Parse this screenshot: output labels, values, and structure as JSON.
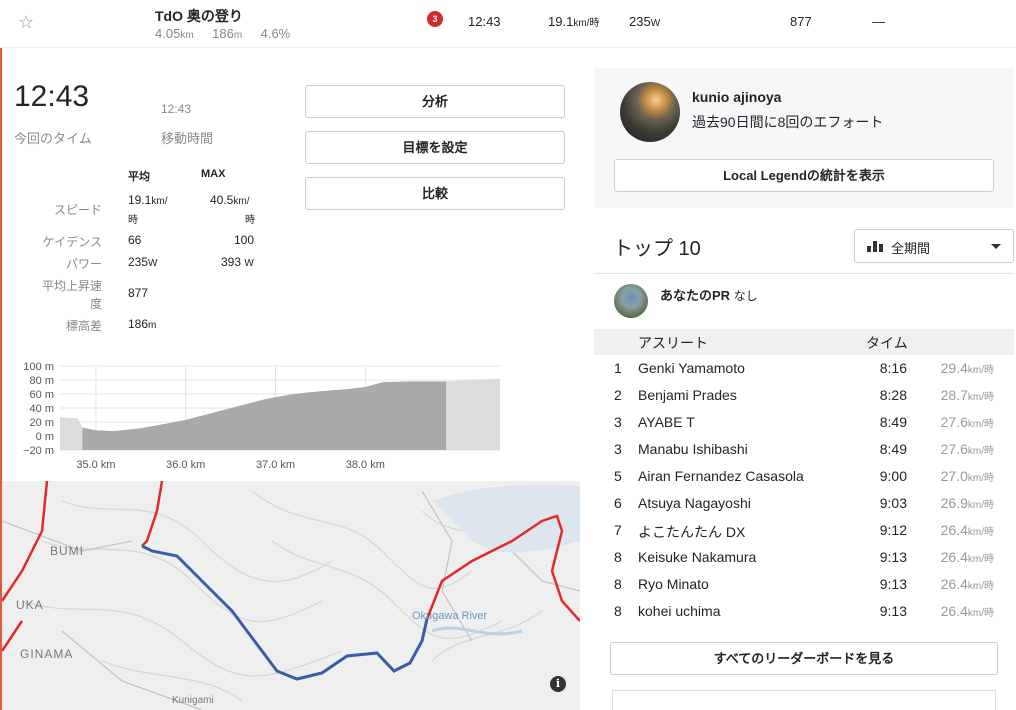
{
  "top_row": {
    "segment_name": "TdO 奥の登り",
    "distance": "4.05",
    "distance_unit": "km",
    "elevation": "186",
    "elevation_unit": "m",
    "grade": "4.6%",
    "badge": "3",
    "time": "12:43",
    "speed": "19.1",
    "speed_unit": "km/時",
    "power": "235",
    "power_unit": "W",
    "vam": "877",
    "hr": "—"
  },
  "stats": {
    "elapsed_time": "12:43",
    "elapsed_label": "今回のタイム",
    "moving_time": "12:43",
    "moving_label": "移動時間",
    "col_avg": "平均",
    "col_max": "MAX",
    "rows": [
      {
        "label": "スピード",
        "avg": "19.1",
        "avg_unit1": "km/",
        "avg_unit2": "時",
        "max": "40.5",
        "max_unit1": "km/",
        "max_unit2": "時"
      },
      {
        "label": "ケイデンス",
        "avg": "66",
        "max": "100"
      },
      {
        "label": "パワー",
        "avg": "235",
        "avg_unit": "W",
        "max": "393",
        "max_unit": "W"
      },
      {
        "label1": "平均上昇速",
        "label2": "度",
        "avg": "877"
      },
      {
        "label": "標高差",
        "avg": "186",
        "avg_unit": "m"
      }
    ]
  },
  "actions": {
    "analyze": "分析",
    "set_goal": "目標を設定",
    "compare": "比較"
  },
  "chart_data": {
    "type": "area",
    "y_ticks": [
      "100 m",
      "80 m",
      "60 m",
      "40 m",
      "20 m",
      "0 m",
      "−20 m"
    ],
    "x_ticks": [
      "35.0 km",
      "36.0 km",
      "37.0 km",
      "38.0 km"
    ],
    "ylim": [
      -20,
      100
    ],
    "xlim": [
      34.6,
      39.5
    ],
    "x": [
      34.6,
      34.8,
      34.85,
      35.0,
      35.2,
      35.5,
      35.8,
      36.0,
      36.3,
      36.6,
      36.9,
      37.2,
      37.5,
      37.8,
      38.0,
      38.2,
      38.5,
      38.9,
      39.5
    ],
    "y": [
      27,
      25,
      12,
      8,
      7,
      11,
      18,
      23,
      33,
      43,
      53,
      60,
      64,
      67,
      70,
      77,
      78,
      78,
      82
    ],
    "segment_x_range": [
      34.85,
      38.9
    ]
  },
  "map": {
    "labels": [
      "BUMI",
      "UKA",
      "GINAMA",
      "Okugawa River",
      "Kunigami"
    ],
    "info": "i"
  },
  "local_legend": {
    "name": "kunio ajinoya",
    "efforts": "過去90日間に8回のエフォート",
    "stats_button": "Local Legendの統計を表示"
  },
  "leaderboard": {
    "title": "トップ 10",
    "filter": "全期間",
    "your_pr_label": "あなたのPR",
    "your_pr_value": "なし",
    "col_athlete": "アスリート",
    "col_time": "タイム",
    "speed_unit": "km/時",
    "rows": [
      {
        "rank": "1",
        "name": "Genki Yamamoto",
        "time": "8:16",
        "speed": "29.4"
      },
      {
        "rank": "2",
        "name": "Benjami Prades",
        "time": "8:28",
        "speed": "28.7"
      },
      {
        "rank": "3",
        "name": "AYABE T",
        "time": "8:49",
        "speed": "27.6"
      },
      {
        "rank": "3",
        "name": "Manabu Ishibashi",
        "time": "8:49",
        "speed": "27.6"
      },
      {
        "rank": "5",
        "name": "Airan Fernandez Casasola",
        "time": "9:00",
        "speed": "27.0"
      },
      {
        "rank": "6",
        "name": "Atsuya Nagayoshi",
        "time": "9:03",
        "speed": "26.9"
      },
      {
        "rank": "7",
        "name": "よこたんたん DX",
        "time": "9:12",
        "speed": "26.4"
      },
      {
        "rank": "8",
        "name": "Keisuke Nakamura",
        "time": "9:13",
        "speed": "26.4"
      },
      {
        "rank": "8",
        "name": "Ryo Minato",
        "time": "9:13",
        "speed": "26.4"
      },
      {
        "rank": "8",
        "name": "kohei uchima",
        "time": "9:13",
        "speed": "26.4"
      }
    ],
    "view_all": "すべてのリーダーボードを見る"
  }
}
